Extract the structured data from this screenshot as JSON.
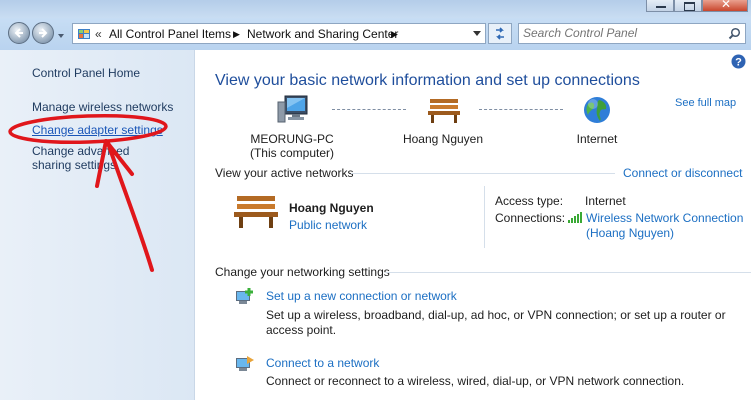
{
  "window": {
    "address": {
      "crumbs": [
        "All Control Panel Items",
        "Network and Sharing Center"
      ],
      "overflow": "«"
    },
    "search_placeholder": "Search Control Panel"
  },
  "sidebar": {
    "items": [
      {
        "label": "Control Panel Home"
      },
      {
        "label": "Manage wireless networks"
      },
      {
        "label": "Change adapter settings"
      },
      {
        "label": "Change advanced sharing settings"
      }
    ]
  },
  "main": {
    "heading": "View your basic network information and set up connections",
    "see_full_map": "See full map",
    "map": {
      "nodes": [
        {
          "label": "MEORUNG-PC",
          "sublabel": "(This computer)",
          "icon": "computer-icon"
        },
        {
          "label": "Hoang Nguyen",
          "icon": "bench-icon"
        },
        {
          "label": "Internet",
          "icon": "globe-icon"
        }
      ]
    },
    "active_networks": {
      "header": "View your active networks",
      "action": "Connect or disconnect",
      "network_name": "Hoang Nguyen",
      "network_type": "Public network",
      "access_type_label": "Access type:",
      "access_type_value": "Internet",
      "connections_label": "Connections:",
      "connection_link_1": "Wireless Network Connection",
      "connection_link_2": "(Hoang Nguyen)"
    },
    "settings": {
      "header": "Change your networking settings",
      "tasks": [
        {
          "title": "Set up a new connection or network",
          "description": "Set up a wireless, broadband, dial-up, ad hoc, or VPN connection; or set up a router or access point."
        },
        {
          "title": "Connect to a network",
          "description": "Connect or reconnect to a wireless, wired, dial-up, or VPN network connection."
        }
      ]
    }
  },
  "colors": {
    "link": "#1c6fc3",
    "heading": "#1f4e9c",
    "annotation": "#e0161b"
  }
}
